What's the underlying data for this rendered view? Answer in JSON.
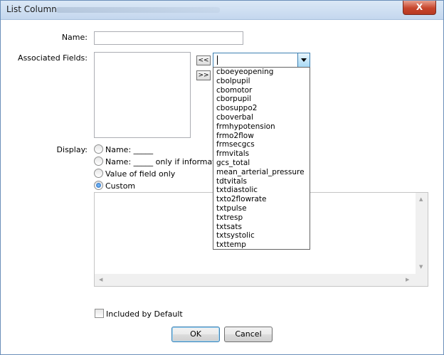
{
  "window": {
    "title": "List Column",
    "close_label": "X"
  },
  "form": {
    "name_label": "Name:",
    "name_value": "",
    "associated_label": "Associated Fields:",
    "add_label": "<<",
    "remove_label": ">>",
    "combo_value": "",
    "display_label": "Display:"
  },
  "dropdown": {
    "items": [
      "cboeyeopening",
      "cbolpupil",
      "cbomotor",
      "cborpupil",
      "cbosuppo2",
      "cboverbal",
      "frmhypotension",
      "frmo2flow",
      "frmsecgcs",
      "frmvitals",
      "gcs_total",
      "mean_arterial_pressure",
      "tdtvitals",
      "txtdiastolic",
      "txto2flowrate",
      "txtpulse",
      "txtresp",
      "txtsats",
      "txtsystolic",
      "txttemp"
    ]
  },
  "display_options": [
    {
      "label": "Name: _____",
      "selected": false
    },
    {
      "label": "Name: _____ only if information i",
      "selected": false
    },
    {
      "label": "Value of field only",
      "selected": false
    },
    {
      "label": "Custom",
      "selected": true
    }
  ],
  "custom_text": "",
  "included_by_default": {
    "label": "Included by Default",
    "checked": false
  },
  "buttons": {
    "ok": "OK",
    "cancel": "Cancel"
  },
  "icons": {
    "combo_arrow": "chevron-down-icon",
    "close": "close-icon"
  }
}
